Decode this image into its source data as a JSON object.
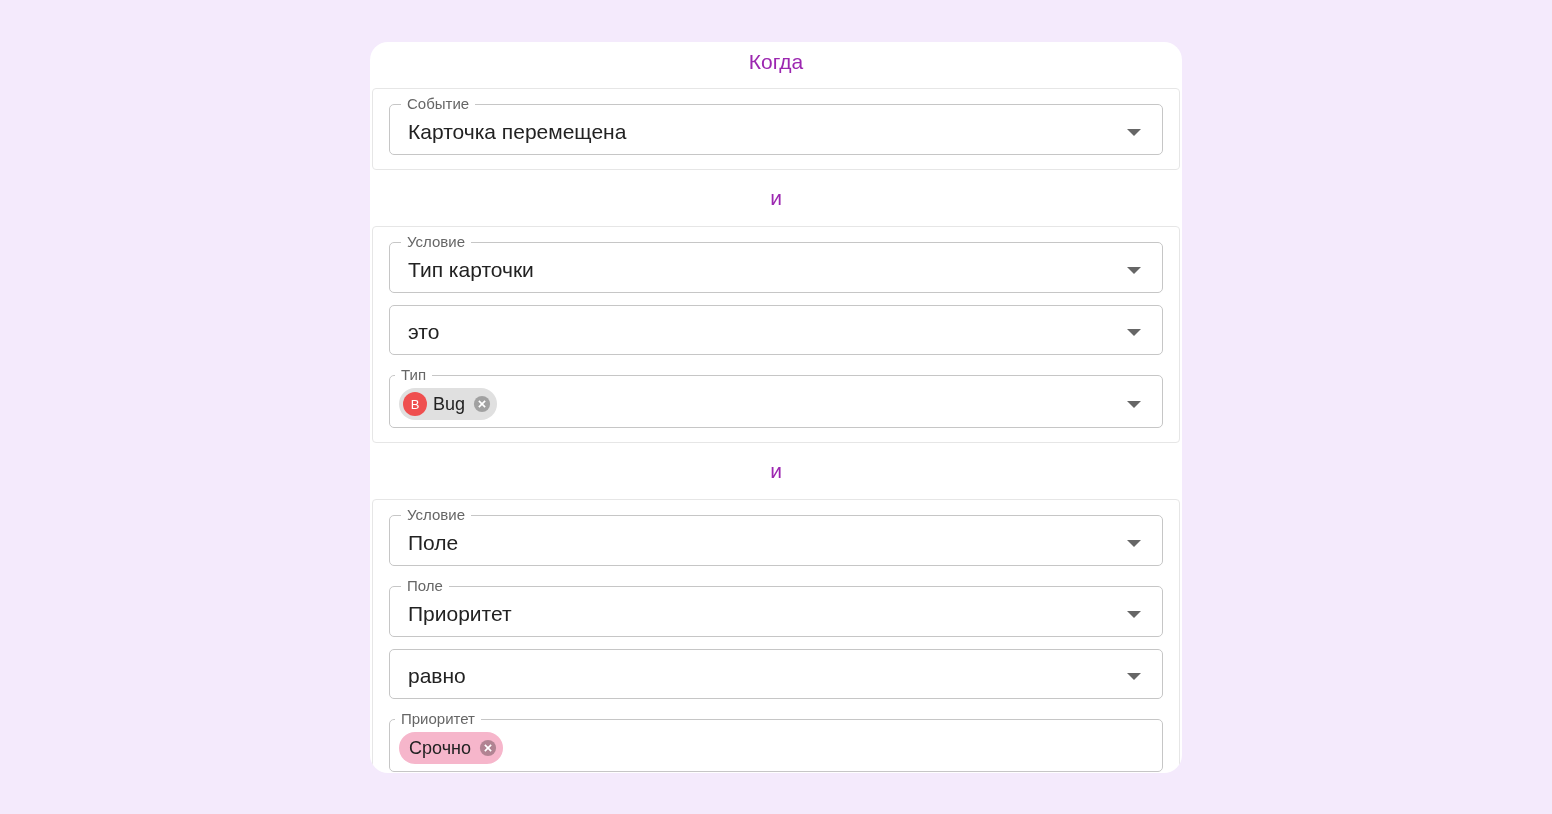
{
  "title": "Когда",
  "groups": [
    {
      "fields": [
        {
          "label": "Событие",
          "value": "Карточка перемещена",
          "dropdown": true
        }
      ]
    },
    {
      "connector": "и",
      "fields": [
        {
          "label": "Условие",
          "value": "Тип карточки",
          "dropdown": true
        },
        {
          "value": "это",
          "dropdown": true
        },
        {
          "label": "Тип",
          "chips": [
            {
              "text": "Bug",
              "color": "#e0e0e0",
              "avatar": {
                "letter": "B",
                "color": "#ef4f4f"
              }
            }
          ],
          "dropdown": true
        }
      ]
    },
    {
      "connector": "и",
      "fields": [
        {
          "label": "Условие",
          "value": "Поле",
          "dropdown": true
        },
        {
          "label": "Поле",
          "value": "Приоритет",
          "dropdown": true
        },
        {
          "value": "равно",
          "dropdown": true
        },
        {
          "label": "Приоритет",
          "chips": [
            {
              "text": "Срочно",
              "color": "#f6b6cb"
            }
          ],
          "dropdown": false
        }
      ]
    }
  ]
}
